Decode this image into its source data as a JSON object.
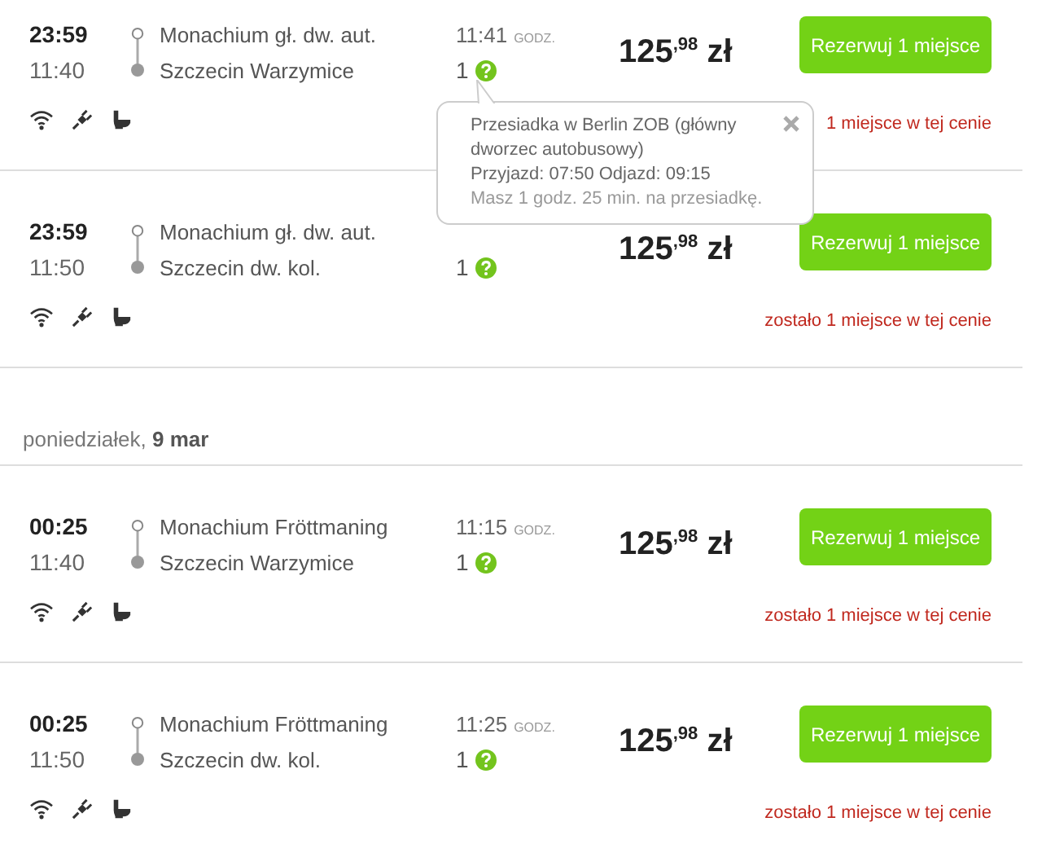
{
  "sections": [
    {
      "trips": [
        {
          "departure": "23:59",
          "arrival": "11:40",
          "from": "Monachium gł. dw. aut.",
          "to": "Szczecin Warzymice",
          "duration": "11:41",
          "duration_unit": "GODZ.",
          "transfers": "1",
          "price": "125",
          "price_fraction": ",98",
          "currency": "zł",
          "button": "Rezerwuj 1 miejsce",
          "availability": "1 miejsce w tej cenie"
        },
        {
          "departure": "23:59",
          "arrival": "11:50",
          "from": "Monachium gł. dw. aut.",
          "to": "Szczecin dw. kol.",
          "transfers": "1",
          "price": "125",
          "price_fraction": ",98",
          "currency": "zł",
          "button": "Rezerwuj 1 miejsce",
          "availability": "zostało 1 miejsce w tej cenie"
        }
      ]
    },
    {
      "date": "poniedziałek, **9 mar**",
      "trips": [
        {
          "departure": "00:25",
          "arrival": "11:40",
          "from": "Monachium Fröttmaning",
          "to": "Szczecin Warzymice",
          "duration": "11:15",
          "duration_unit": "GODZ.",
          "transfers": "1",
          "price": "125",
          "price_fraction": ",98",
          "currency": "zł",
          "button": "Rezerwuj 1 miejsce",
          "availability": "zostało 1 miejsce w tej cenie"
        },
        {
          "departure": "00:25",
          "arrival": "11:50",
          "from": "Monachium Fröttmaning",
          "to": "Szczecin dw. kol.",
          "duration": "11:25",
          "duration_unit": "GODZ.",
          "transfers": "1",
          "price": "125",
          "price_fraction": ",98",
          "currency": "zł",
          "button": "Rezerwuj 1 miejsce",
          "availability": "zostało 1 miejsce w tej cenie"
        }
      ]
    }
  ],
  "tooltip": {
    "lines": [
      {
        "text": "Przesiadka w Berlin ZOB (główny dworzec autobusowy)",
        "muted": false
      },
      {
        "text": "Przyjazd: 07:50 Odjazd: 09:15",
        "muted": false
      },
      {
        "text": "Masz 1 godz. 25 min. na przesiadkę.",
        "muted": true
      }
    ]
  }
}
